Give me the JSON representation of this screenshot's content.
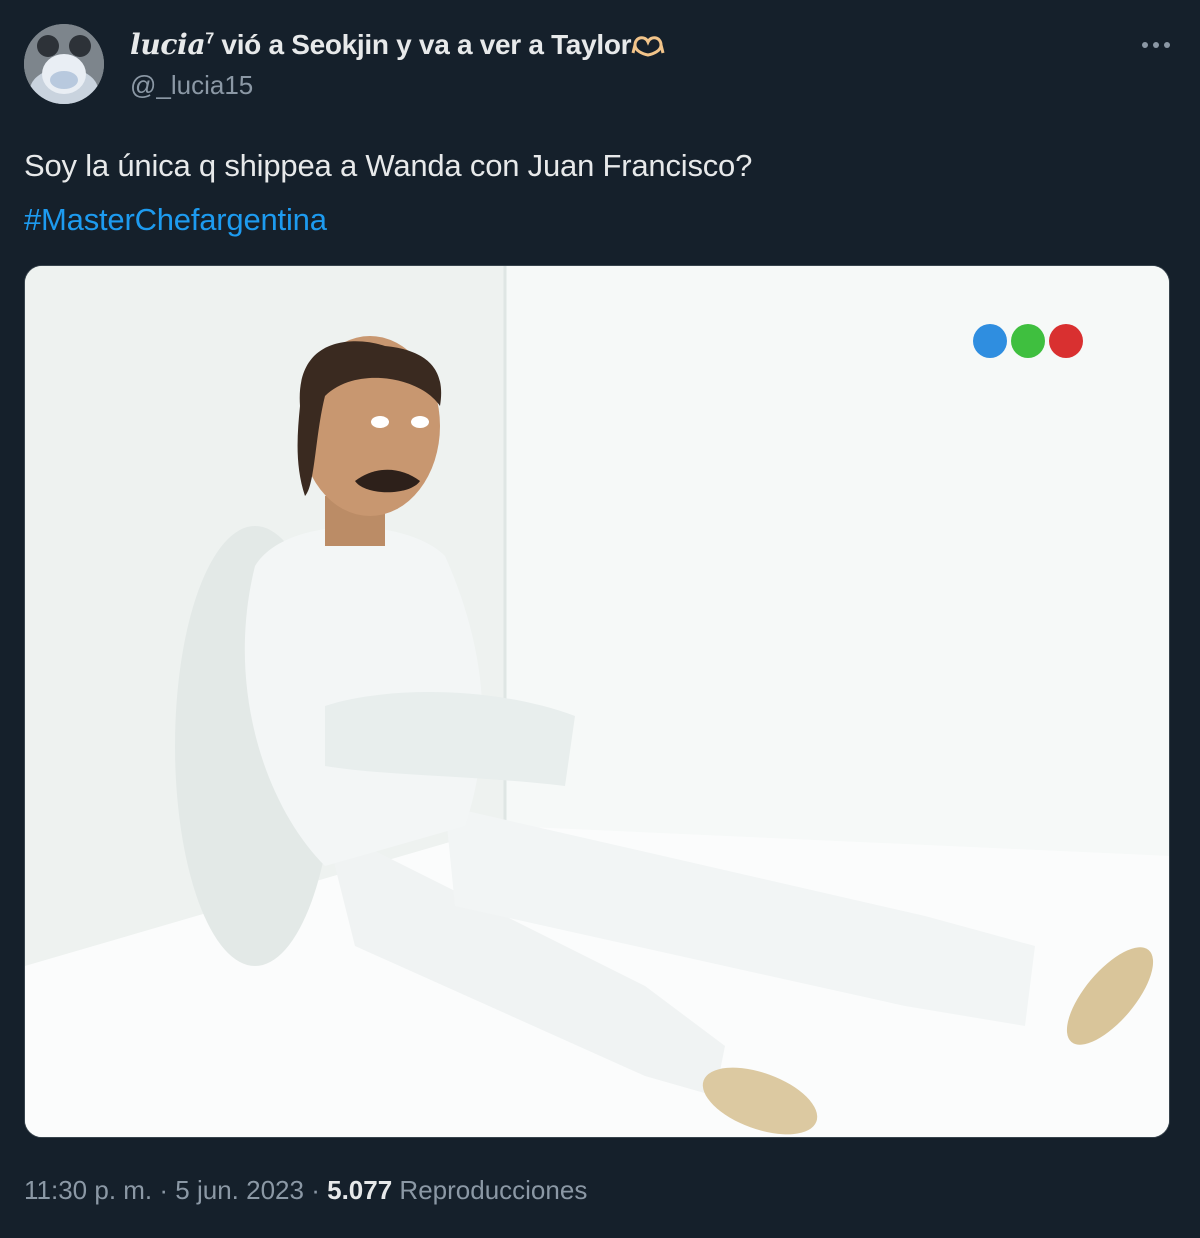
{
  "user": {
    "display_name_stylized": "lucia",
    "display_name_superscript": "7",
    "display_name_rest": " vió a Seokjin y va a ver a Taylor",
    "handle": "@_lucia15",
    "avatar_icon": "avatar-icon"
  },
  "tweet": {
    "text": "Soy la única q shippea a Wanda con Juan Francisco?",
    "hashtag": "#MasterChefargentina"
  },
  "meta": {
    "time": "11:30 p. m.",
    "separator": "·",
    "date": "5 jun. 2023",
    "views_count": "5.077",
    "views_label": "Reproducciones"
  },
  "icons": {
    "more": "more-options-icon",
    "heart": "hand-heart-icon",
    "tv_logo": "tv-channel-logo-icon"
  },
  "colors": {
    "background": "#15202b",
    "text_primary": "#e7e9ea",
    "text_secondary": "#8b98a5",
    "link": "#1d9bf0"
  }
}
